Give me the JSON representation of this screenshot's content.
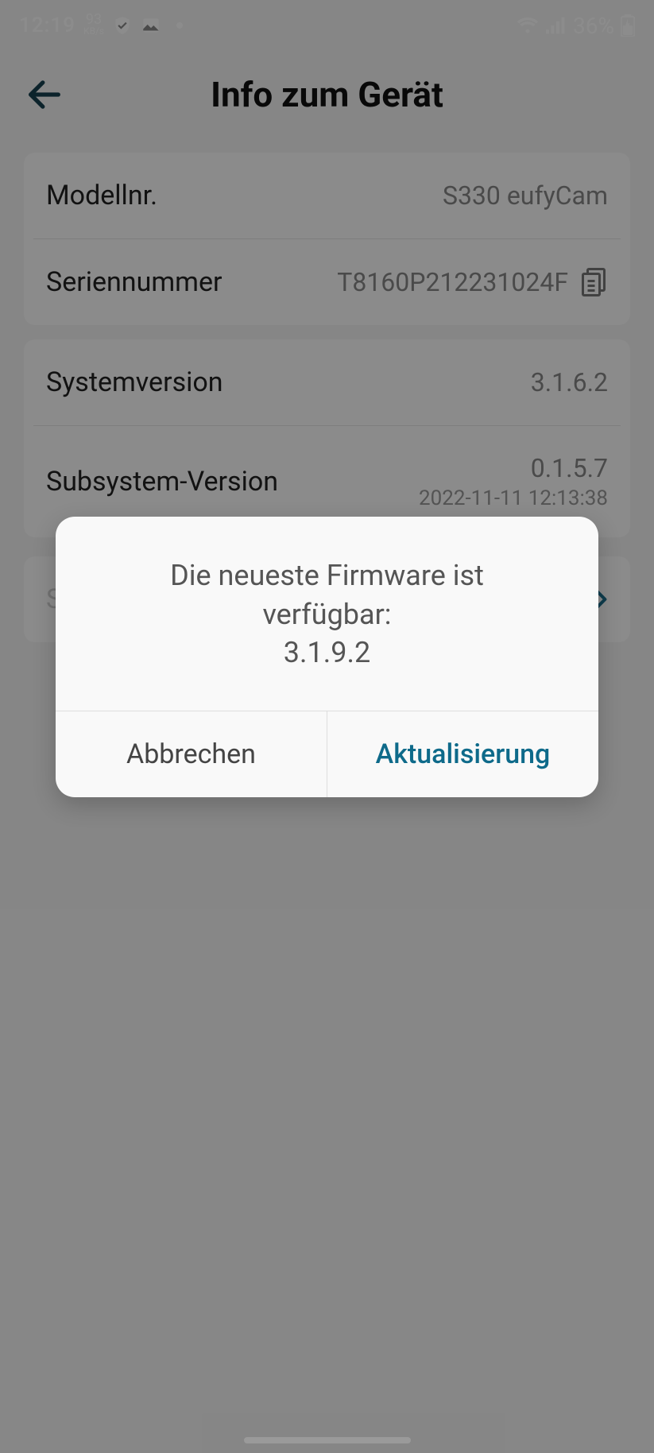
{
  "status": {
    "time": "12:19",
    "speed_value": "93",
    "speed_unit": "KB/s",
    "battery_text": "36%"
  },
  "header": {
    "title": "Info zum Gerät"
  },
  "card1": {
    "model_label": "Modellnr.",
    "model_value": "S330 eufyCam",
    "serial_label": "Seriennummer",
    "serial_value": "T8160P212231024F"
  },
  "card2": {
    "sysver_label": "Systemversion",
    "sysver_value": "3.1.6.2",
    "subsys_label": "Subsystem-Version",
    "subsys_value": "0.1.5.7",
    "subsys_date": "2022-11-11 12:13:38"
  },
  "dialog": {
    "line1": "Die neueste Firmware ist",
    "line2": "verfügbar:",
    "version": "3.1.9.2",
    "cancel": "Abbrechen",
    "update": "Aktualisierung"
  }
}
